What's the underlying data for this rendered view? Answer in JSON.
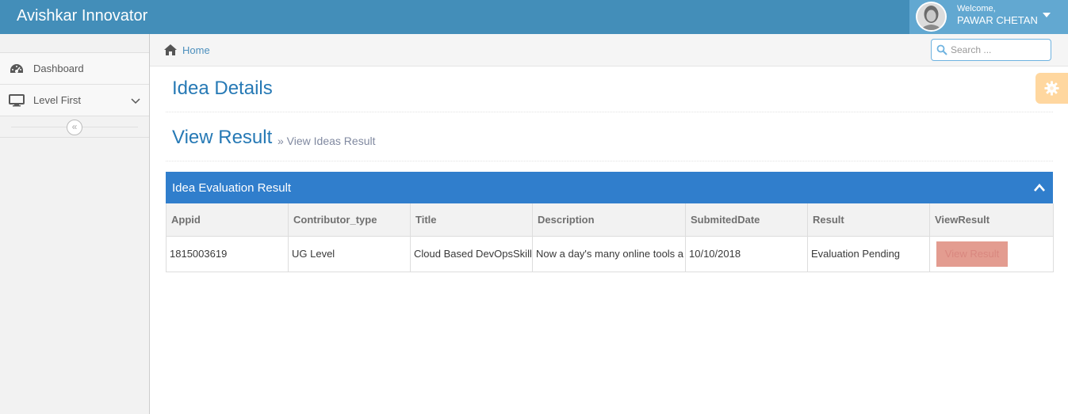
{
  "navbar": {
    "brand": "Avishkar Innovator",
    "user": {
      "welcome": "Welcome,",
      "name": "PAWAR CHETAN"
    }
  },
  "sidebar": {
    "items": [
      {
        "label": "Dashboard",
        "icon": "tachometer-icon"
      },
      {
        "label": "Level First",
        "icon": "desktop-icon"
      }
    ]
  },
  "breadcrumbs": {
    "home": "Home"
  },
  "search": {
    "placeholder": "Search ..."
  },
  "page": {
    "title": "Idea Details",
    "section_title": "View Result",
    "section_subtitle": "» View Ideas Result"
  },
  "widget": {
    "title": "Idea Evaluation Result",
    "columns": [
      "Appid",
      "Contributor_type",
      "Title",
      "Description",
      "SubmitedDate",
      "Result",
      "ViewResult"
    ],
    "rows": [
      {
        "appid": "1815003619",
        "contributor_type": "UG Level",
        "title": "Cloud Based DevOpsSkill",
        "description": "Now a day's many online tools a",
        "submited_date": "10/10/2018",
        "result": "Evaluation Pending",
        "view_result": "View Result"
      }
    ]
  },
  "colors": {
    "navbar": "#438eb9",
    "widget_header": "#307ecc",
    "heading": "#2679b5",
    "button": "#d15b47"
  }
}
